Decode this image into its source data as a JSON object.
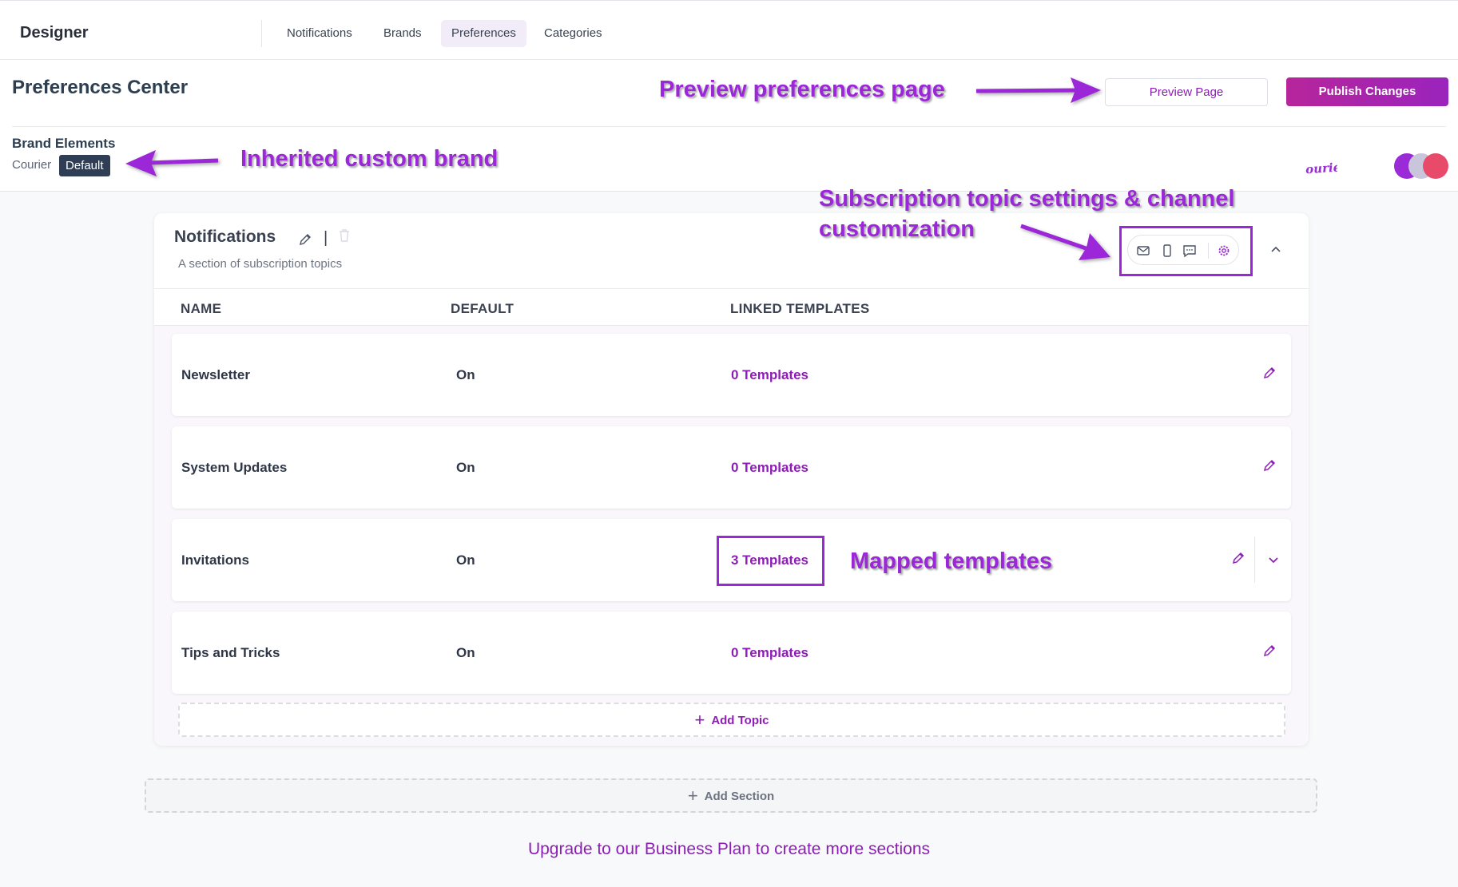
{
  "app": {
    "title": "Designer"
  },
  "nav": {
    "tabs": [
      "Notifications",
      "Brands",
      "Preferences",
      "Categories"
    ],
    "active": "Preferences"
  },
  "page": {
    "title": "Preferences Center",
    "preview_button": "Preview Page",
    "publish_button": "Publish Changes"
  },
  "brand": {
    "label": "Brand Elements",
    "name": "Courier",
    "badge": "Default",
    "logo_text": "Courier",
    "swatch_colors": [
      "#9a2bd6",
      "#c9c6dc",
      "#e84b6a"
    ]
  },
  "section": {
    "title": "Notifications",
    "separator": "|",
    "subtitle": "A section of subscription topics",
    "columns": {
      "name": "NAME",
      "default": "DEFAULT",
      "templates": "LINKED TEMPLATES"
    },
    "rows": [
      {
        "name": "Newsletter",
        "default": "On",
        "templates": "0 Templates"
      },
      {
        "name": "System Updates",
        "default": "On",
        "templates": "0 Templates"
      },
      {
        "name": "Invitations",
        "default": "On",
        "templates": "3 Templates"
      },
      {
        "name": "Tips and Tricks",
        "default": "On",
        "templates": "0 Templates"
      }
    ],
    "add_topic": "Add Topic"
  },
  "add_section": "Add Section",
  "upgrade": "Upgrade to our Business Plan to create more sections",
  "annotations": {
    "preview": "Preview preferences page",
    "brand": "Inherited custom brand",
    "subscription_line1": "Subscription topic settings & channel",
    "subscription_line2": "customization",
    "mapped": "Mapped templates"
  },
  "colors": {
    "accent": "#8e1db8",
    "annotation": "#9c27d9",
    "publish": "#a524b0"
  },
  "icons": {
    "channels": [
      "email-icon",
      "push-icon",
      "chat-icon",
      "settings-icon"
    ]
  }
}
